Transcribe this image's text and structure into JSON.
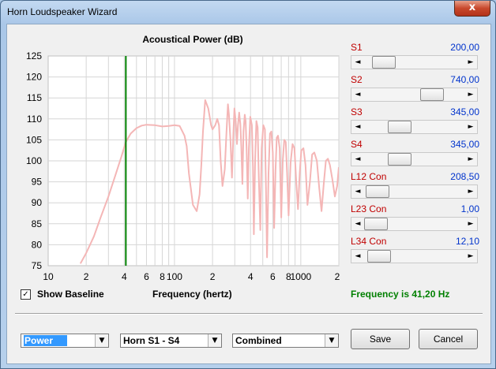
{
  "window": {
    "title": "Horn Loudspeaker Wizard",
    "close_label": "x"
  },
  "chart_data": {
    "type": "line",
    "title": "Acoustical Power (dB)",
    "xlabel": "Frequency (hertz)",
    "ylabel": "",
    "x_scale": "log",
    "xlim": [
      10,
      2000
    ],
    "ylim": [
      75,
      125
    ],
    "y_ticks": [
      "125",
      "120",
      "115",
      "110",
      "105",
      "100",
      "95",
      "90",
      "85",
      "80",
      "75"
    ],
    "x_ticks": [
      "10",
      "2",
      "4",
      "6",
      "8",
      "100",
      "2",
      "4",
      "6",
      "8",
      "1000",
      "2"
    ],
    "grid": true,
    "marker_frequency": 41.2,
    "marker_color": "#008000",
    "line_color": "#f4b6b6",
    "series": [
      {
        "x": [
          18,
          20,
          23,
          26,
          30,
          34,
          38,
          41.2,
          45,
          50,
          55,
          60,
          70,
          80,
          90,
          100,
          110,
          120,
          125,
          130,
          140,
          150,
          158,
          163,
          168,
          175,
          185,
          195,
          200,
          210,
          218,
          225,
          232,
          240,
          250,
          258,
          265,
          270,
          278,
          285,
          292,
          298,
          305,
          312,
          318,
          325,
          332,
          338,
          345,
          352,
          360,
          366,
          372,
          380,
          388,
          398,
          410,
          418,
          425,
          435,
          445,
          455,
          465,
          478,
          490,
          505,
          520,
          530,
          540,
          555,
          570,
          585,
          600,
          615,
          630,
          645,
          660,
          680,
          700,
          720,
          740,
          760,
          780,
          800,
          830,
          860,
          890,
          920,
          950,
          980,
          1010,
          1050,
          1090,
          1130,
          1180,
          1230,
          1280,
          1340,
          1400,
          1460,
          1520,
          1580,
          1640,
          1700,
          1780,
          1860,
          1940,
          2000
        ],
        "values": [
          75.5,
          78,
          82,
          86.5,
          91.5,
          96.5,
          101,
          104.5,
          106.5,
          107.8,
          108.4,
          108.6,
          108.5,
          108.2,
          108.3,
          108.5,
          108.3,
          106,
          103.5,
          97,
          89.5,
          88,
          92,
          99,
          107,
          114.5,
          112.5,
          108.5,
          107.5,
          108.5,
          110,
          108.5,
          100,
          94,
          98,
          107,
          113.5,
          111,
          104.5,
          96,
          106,
          112.5,
          109.5,
          104,
          108.5,
          111.5,
          108.8,
          103.5,
          94.5,
          107,
          111,
          109.5,
          103,
          91,
          103,
          110.5,
          108.5,
          98.5,
          82.5,
          100,
          109.5,
          108,
          96,
          83.5,
          103,
          108.5,
          107.5,
          93,
          77,
          97,
          106.5,
          107,
          102,
          84,
          97.5,
          105.5,
          106,
          103,
          86.5,
          100,
          105,
          104.5,
          96.5,
          87,
          99.5,
          104,
          103,
          95,
          88.5,
          97,
          102.5,
          103,
          99,
          89.5,
          95,
          101.5,
          102,
          100,
          93.5,
          88,
          94.5,
          100,
          100.5,
          99,
          95.5,
          91.5,
          94,
          98.5
        ]
      }
    ]
  },
  "sliders": [
    {
      "label": "S1",
      "value": "200,00",
      "pos": 0.1
    },
    {
      "label": "S2",
      "value": "740,00",
      "pos": 0.72
    },
    {
      "label": "S3",
      "value": "345,00",
      "pos": 0.3
    },
    {
      "label": "S4",
      "value": "345,00",
      "pos": 0.3
    },
    {
      "label": "L12 Con",
      "value": "208,50",
      "pos": 0.02
    },
    {
      "label": "L23 Con",
      "value": "1,00",
      "pos": 0.0
    },
    {
      "label": "L34 Con",
      "value": "12,10",
      "pos": 0.04
    }
  ],
  "show_baseline": {
    "label": "Show Baseline",
    "checked": true,
    "mark": "✓"
  },
  "status": {
    "frequency_text": "Frequency is 41,20 Hz"
  },
  "combos": {
    "mode": "Power",
    "horn": "Horn S1 - S4",
    "view": "Combined",
    "arrow": "▼"
  },
  "buttons": {
    "save": "Save",
    "cancel": "Cancel"
  },
  "arrows": {
    "left": "◄",
    "right": "►"
  }
}
